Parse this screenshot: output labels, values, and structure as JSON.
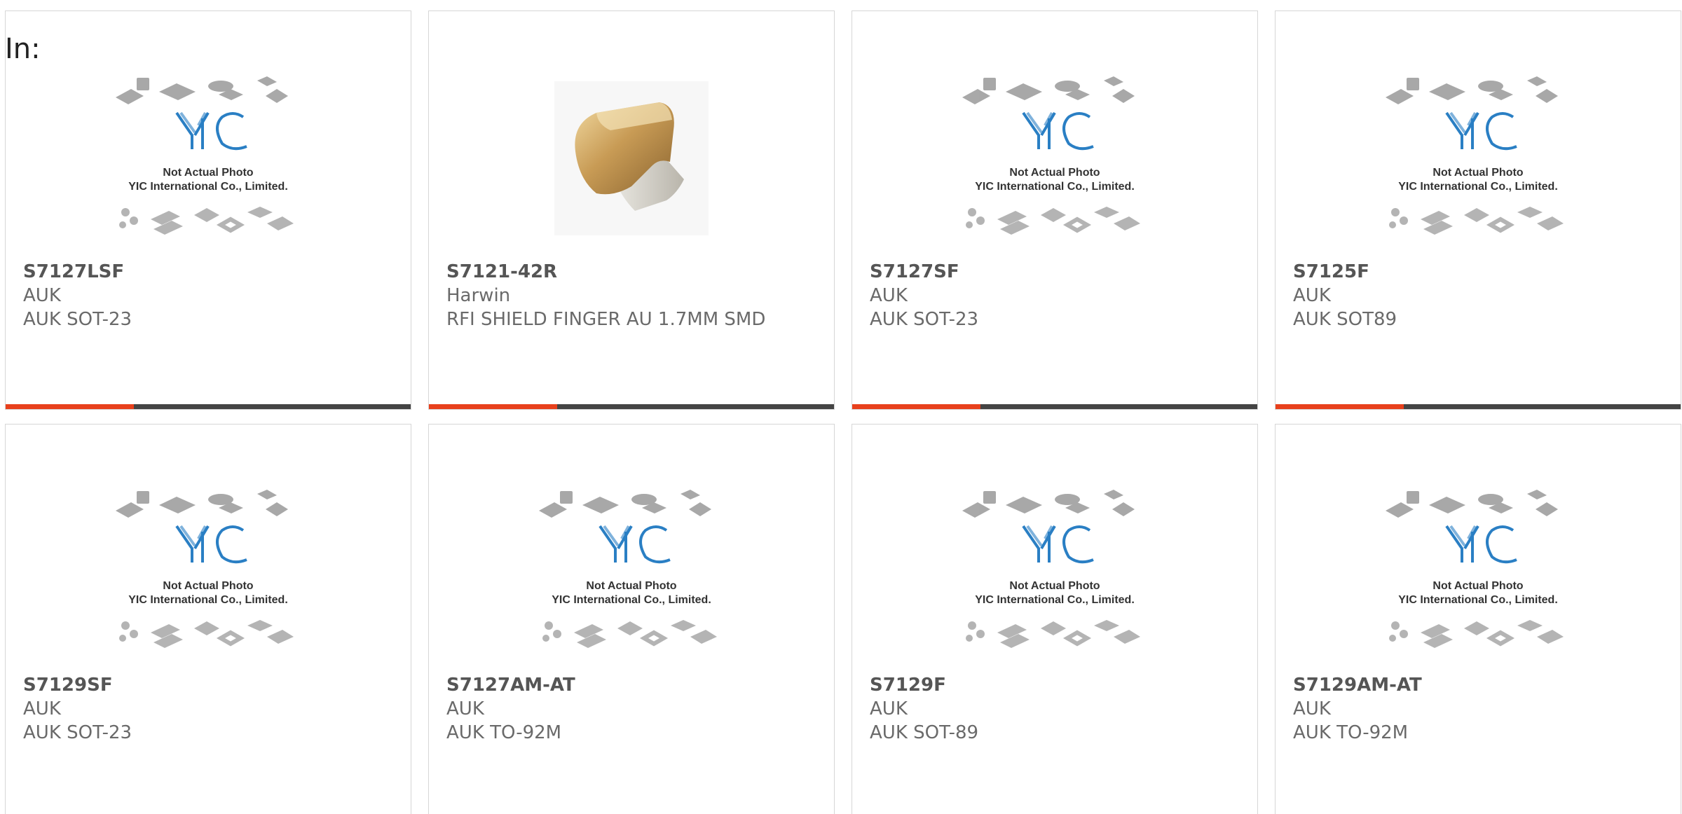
{
  "header": {
    "prefix": "In:"
  },
  "placeholder_image": {
    "logo_text": "YIC",
    "line1": "Not Actual Photo",
    "line2": "YIC International Co., Limited."
  },
  "colors": {
    "accent": "#e8401c",
    "bar": "#444444",
    "logo_blue": "#2a7fc4"
  },
  "products": [
    {
      "part": "S7127LSF",
      "maker": "AUK",
      "desc": "AUK SOT-23",
      "image": "yic-placeholder"
    },
    {
      "part": "S7121-42R",
      "maker": "Harwin",
      "desc": "RFI SHIELD FINGER AU 1.7MM SMD",
      "image": "gold-shield-finger"
    },
    {
      "part": "S7127SF",
      "maker": "AUK",
      "desc": "AUK SOT-23",
      "image": "yic-placeholder"
    },
    {
      "part": "S7125F",
      "maker": "AUK",
      "desc": "AUK SOT89",
      "image": "yic-placeholder"
    },
    {
      "part": "S7129SF",
      "maker": "AUK",
      "desc": "AUK SOT-23",
      "image": "yic-placeholder"
    },
    {
      "part": "S7127AM-AT",
      "maker": "AUK",
      "desc": "AUK TO-92M",
      "image": "yic-placeholder"
    },
    {
      "part": "S7129F",
      "maker": "AUK",
      "desc": "AUK SOT-89",
      "image": "yic-placeholder"
    },
    {
      "part": "S7129AM-AT",
      "maker": "AUK",
      "desc": "AUK TO-92M",
      "image": "yic-placeholder"
    }
  ]
}
